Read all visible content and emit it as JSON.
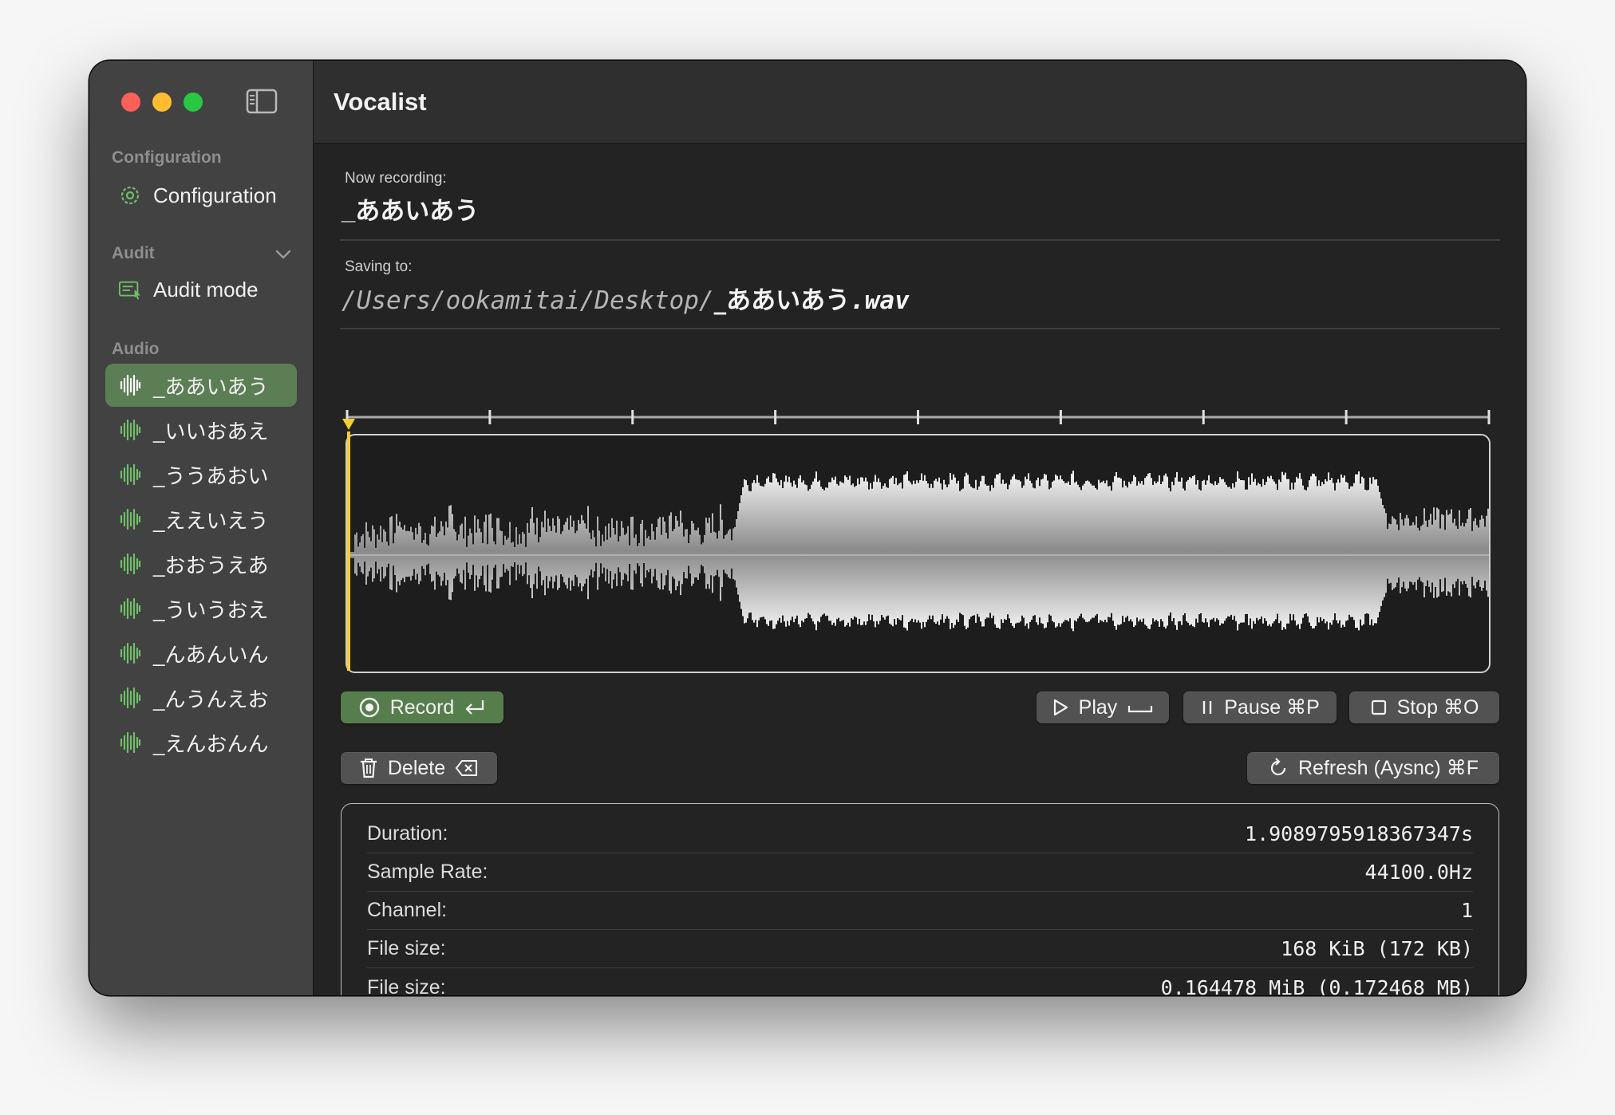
{
  "app": {
    "title": "Vocalist"
  },
  "sidebar": {
    "sections": {
      "configuration": "Configuration",
      "audit": "Audit",
      "audio": "Audio"
    },
    "configuration_item": "Configuration",
    "audit_item": "Audit mode",
    "audio_items": [
      {
        "label": "_ああいあう",
        "selected": true
      },
      {
        "label": "_いいおあえ",
        "selected": false
      },
      {
        "label": "_ううあおい",
        "selected": false
      },
      {
        "label": "_ええいえう",
        "selected": false
      },
      {
        "label": "_おおうえあ",
        "selected": false
      },
      {
        "label": "_ういうおえ",
        "selected": false
      },
      {
        "label": "_んあんいん",
        "selected": false
      },
      {
        "label": "_んうんえお",
        "selected": false
      },
      {
        "label": "_えんおんん",
        "selected": false
      }
    ]
  },
  "recording": {
    "now_caption": "Now recording:",
    "now_name": "_ああいあう",
    "saving_caption": "Saving to:",
    "path_dir": "/Users/ookamitai/Desktop/",
    "path_name": "_ああいあう",
    "path_ext": ".wav"
  },
  "controls": {
    "record": "Record",
    "play": "Play",
    "pause": "Pause ⌘P",
    "stop": "Stop ⌘O",
    "delete": "Delete",
    "refresh": "Refresh (Aysnc) ⌘F"
  },
  "info": [
    {
      "label": "Duration:",
      "value": "1.9089795918367347s"
    },
    {
      "label": "Sample Rate:",
      "value": "44100.0Hz"
    },
    {
      "label": "Channel:",
      "value": "1"
    },
    {
      "label": "File size:",
      "value": "168 KiB (172 KB)"
    },
    {
      "label": "File size:",
      "value": "0.164478 MiB (0.172468 MB)"
    }
  ],
  "colors": {
    "accent_green": "#567e4c",
    "playhead": "#f5cf2c",
    "waveform": "#e6e6e6"
  }
}
